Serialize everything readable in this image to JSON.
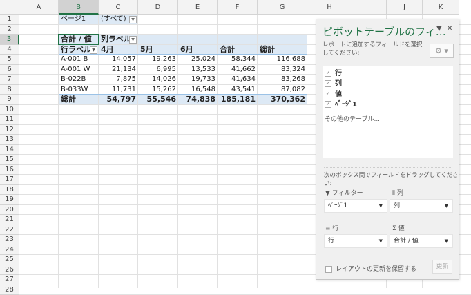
{
  "columns": [
    "A",
    "B",
    "C",
    "D",
    "E",
    "F",
    "G",
    "H",
    "I",
    "J",
    "K"
  ],
  "selected_column": "B",
  "selected_row": 3,
  "rows": 28,
  "filter": {
    "label": "ページ1",
    "value": "(すべて)"
  },
  "pivot": {
    "corner": "合計 / 値",
    "col_labels": "列ラベル",
    "row_labels": "行ラベル",
    "headers": [
      "4月",
      "5月",
      "6月",
      "合計",
      "総計"
    ],
    "data": [
      {
        "label": "A-001 B",
        "values": [
          "14,057",
          "19,263",
          "25,024",
          "58,344",
          "116,688"
        ]
      },
      {
        "label": "A-001 W",
        "values": [
          "21,134",
          "6,995",
          "13,533",
          "41,662",
          "83,324"
        ]
      },
      {
        "label": "B-022B",
        "values": [
          "7,875",
          "14,026",
          "19,733",
          "41,634",
          "83,268"
        ]
      },
      {
        "label": "B-033W",
        "values": [
          "11,731",
          "15,262",
          "16,548",
          "43,541",
          "87,082"
        ]
      }
    ],
    "total": {
      "label": "総計",
      "values": [
        "54,797",
        "55,546",
        "74,838",
        "185,181",
        "370,362"
      ]
    }
  },
  "pane": {
    "title": "ピボットテーブルのフィ…",
    "instruction": "レポートに追加するフィールドを選択してください:",
    "fields": [
      {
        "name": "行",
        "checked": true
      },
      {
        "name": "列",
        "checked": true
      },
      {
        "name": "値",
        "checked": true
      },
      {
        "name": "ﾍﾟｰｼﾞ1",
        "checked": true
      }
    ],
    "more_tables": "その他のテーブル...",
    "drag_instruction": "次のボックス間でフィールドをドラッグしてください:",
    "filters_label": "フィルター",
    "filters_value": "ﾍﾟｰｼﾞ1",
    "columns_label": "列",
    "columns_value": "列",
    "rows_label": "行",
    "rows_value": "行",
    "values_label": "値",
    "values_value": "合計 / 値",
    "defer_label": "レイアウトの更新を保留する",
    "update_button": "更新"
  },
  "colors": {
    "accent": "#217346",
    "pivot_band": "#dde9f5"
  }
}
